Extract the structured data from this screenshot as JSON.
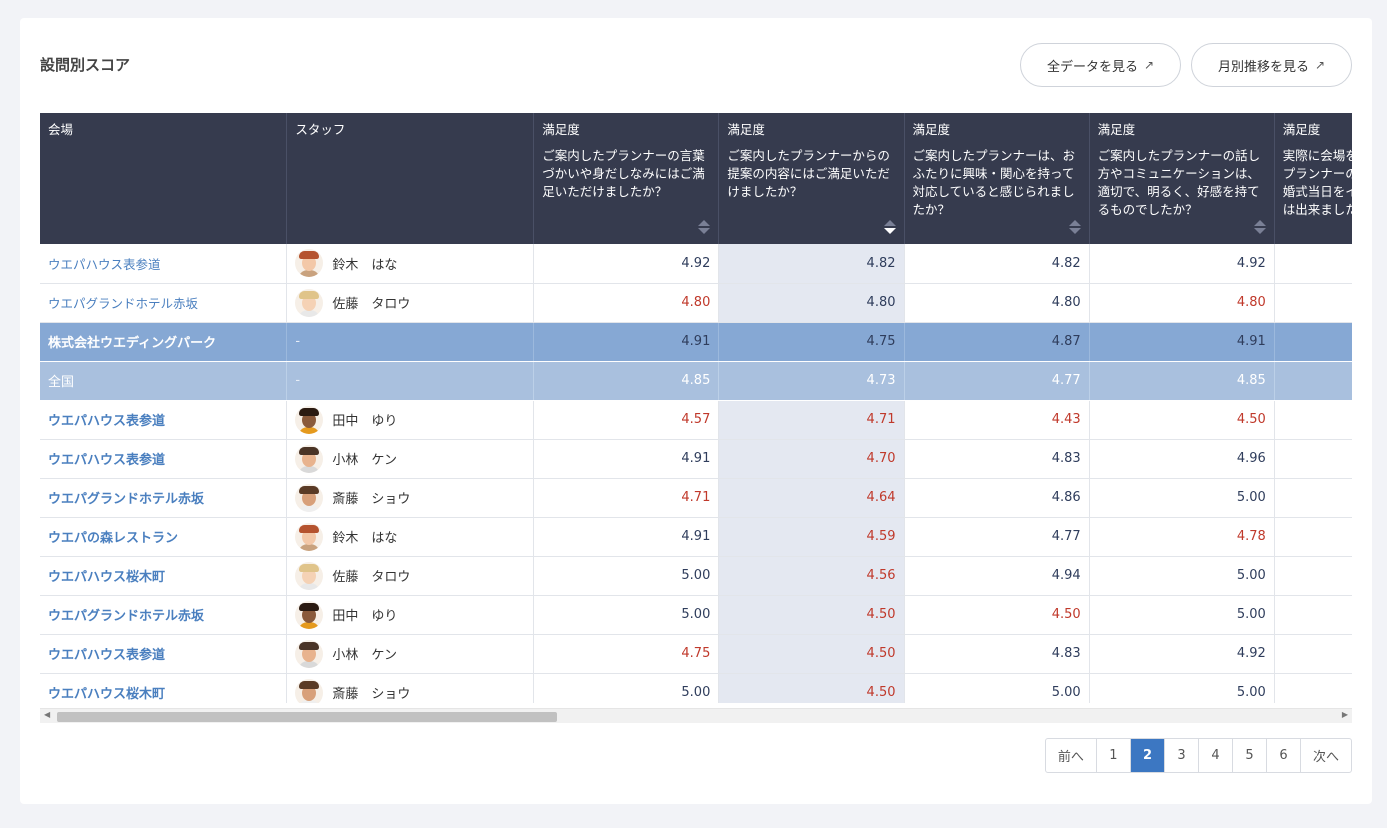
{
  "card": {
    "title": "設問別スコア"
  },
  "buttons": {
    "all_data": "全データを見る",
    "monthly": "月別推移を見る",
    "ext_icon": "↗"
  },
  "table": {
    "headers": {
      "venue": "会場",
      "staff": "スタッフ",
      "q": [
        {
          "label": "満足度",
          "text": "ご案内したプランナーの言葉づかいや身だしなみにはご満足いただけましたか？"
        },
        {
          "label": "満足度",
          "text": "ご案内したプランナーからの提案の内容にはご満足いただけましたか？"
        },
        {
          "label": "満足度",
          "text": "ご案内したプランナーは、おふたりに興味・関心を持って対応していると感じられましたか？"
        },
        {
          "label": "満足度",
          "text": "ご案内したプランナーの話し方やコミュニケーションは、適切で、明るく、好感を持てるものでしたか？"
        },
        {
          "label": "満足度",
          "text": "実際に会場をご覧頂いた際、プランナーの説明によって結婚式当日をイメージすることは出来ましたか？"
        }
      ]
    },
    "rows": [
      {
        "venue": "ウエパハウス表参道",
        "staff": "鈴木　はな",
        "avatar": "female-redhair",
        "scores": [
          "4.92",
          "4.82",
          "4.82",
          "4.92"
        ],
        "red": [
          false,
          false,
          false,
          false
        ]
      },
      {
        "venue": "ウエパグランドホテル赤坂",
        "staff": "佐藤　タロウ",
        "avatar": "male-blond",
        "scores": [
          "4.80",
          "4.80",
          "4.80",
          "4.80"
        ],
        "red": [
          true,
          false,
          false,
          true
        ]
      },
      {
        "venue": "株式会社ウエディングパーク",
        "staff": "-",
        "scores": [
          "4.91",
          "4.75",
          "4.87",
          "4.91"
        ],
        "kind": "agg1"
      },
      {
        "venue": "全国",
        "staff": "-",
        "scores": [
          "4.85",
          "4.73",
          "4.77",
          "4.85"
        ],
        "kind": "agg2"
      },
      {
        "venue": "ウエパハウス表参道",
        "staff": "田中　ゆり",
        "avatar": "female-dark",
        "scores": [
          "4.57",
          "4.71",
          "4.43",
          "4.50"
        ],
        "red": [
          true,
          true,
          true,
          true
        ]
      },
      {
        "venue": "ウエパハウス表参道",
        "staff": "小林　ケン",
        "avatar": "male-beard",
        "scores": [
          "4.91",
          "4.70",
          "4.83",
          "4.96"
        ],
        "red": [
          false,
          true,
          false,
          false
        ]
      },
      {
        "venue": "ウエパグランドホテル赤坂",
        "staff": "斎藤　ショウ",
        "avatar": "male-brown",
        "scores": [
          "4.71",
          "4.64",
          "4.86",
          "5.00"
        ],
        "red": [
          true,
          true,
          false,
          false
        ]
      },
      {
        "venue": "ウエパの森レストラン",
        "staff": "鈴木　はな",
        "avatar": "female-redhair",
        "scores": [
          "4.91",
          "4.59",
          "4.77",
          "4.78"
        ],
        "red": [
          false,
          true,
          false,
          true
        ]
      },
      {
        "venue": "ウエパハウス桜木町",
        "staff": "佐藤　タロウ",
        "avatar": "male-blond",
        "scores": [
          "5.00",
          "4.56",
          "4.94",
          "5.00"
        ],
        "red": [
          false,
          true,
          false,
          false
        ]
      },
      {
        "venue": "ウエパグランドホテル赤坂",
        "staff": "田中　ゆり",
        "avatar": "female-dark",
        "scores": [
          "5.00",
          "4.50",
          "4.50",
          "5.00"
        ],
        "red": [
          false,
          true,
          true,
          false
        ]
      },
      {
        "venue": "ウエパハウス表参道",
        "staff": "小林　ケン",
        "avatar": "male-beard",
        "scores": [
          "4.75",
          "4.50",
          "4.83",
          "4.92"
        ],
        "red": [
          true,
          true,
          false,
          false
        ]
      },
      {
        "venue": "ウエパハウス桜木町",
        "staff": "斎藤　ショウ",
        "avatar": "male-brown",
        "scores": [
          "5.00",
          "4.50",
          "5.00",
          "5.00"
        ],
        "red": [
          false,
          true,
          false,
          false
        ]
      }
    ]
  },
  "pagination": {
    "prev": "前へ",
    "next": "次へ",
    "pages": [
      "1",
      "2",
      "3",
      "4",
      "5",
      "6"
    ],
    "current": "2"
  },
  "colors": {
    "header": "#363b4e",
    "link": "#4a7fbf",
    "red": "#c0392b",
    "accent": "#3c77c2",
    "agg1": "#86a8d4",
    "agg2": "#a9c0de"
  }
}
